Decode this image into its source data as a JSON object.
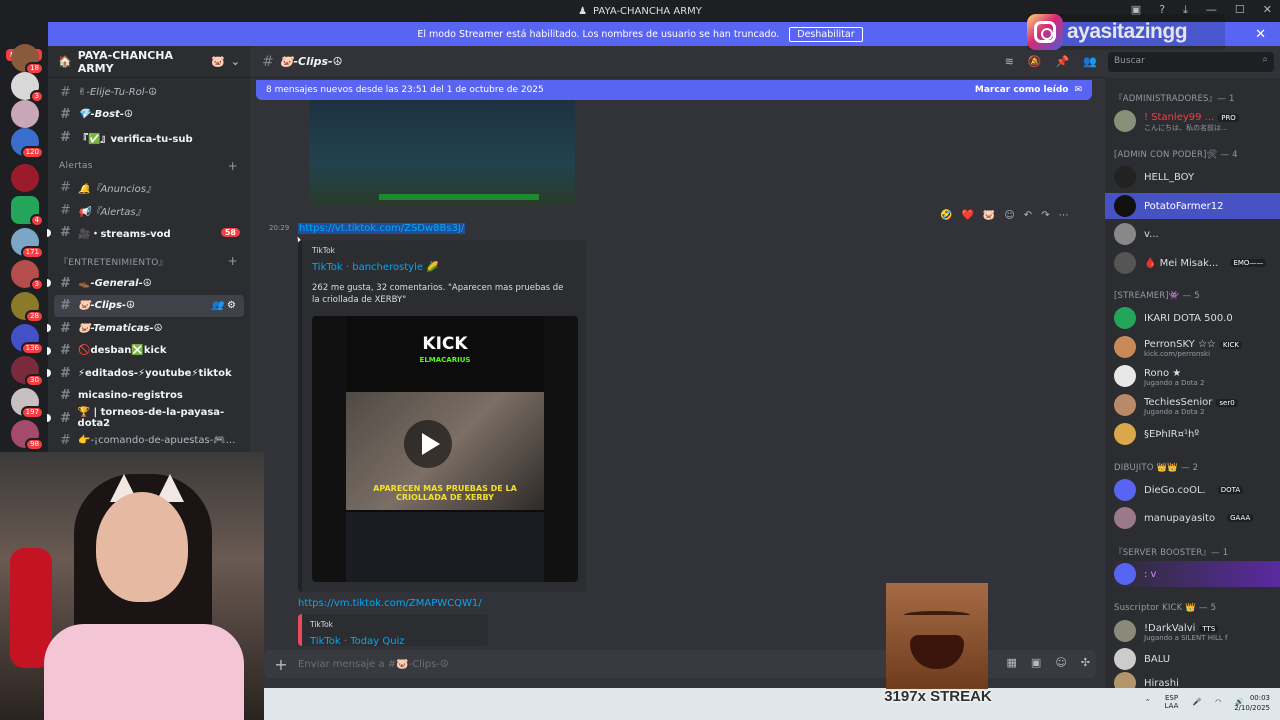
{
  "app": {
    "title": "PAYA-CHANCHA ARMY"
  },
  "banner": {
    "text": "El modo Streamer está habilitado. Los nombres de usuario se han truncado.",
    "button": "Deshabilitar"
  },
  "overlay": {
    "instagram": "ayasitazingg",
    "streak": "3197x STREAK"
  },
  "servers": {
    "new_label": "NUEVO",
    "badges": [
      "18",
      "3",
      "120",
      "4",
      "171",
      "3",
      "28",
      "136",
      "30",
      "197",
      "98"
    ]
  },
  "server": {
    "name": "PAYA-CHANCHA ARMY"
  },
  "channels": [
    {
      "name": "✌-Elije-Tu-Rol-☮",
      "style": "italic"
    },
    {
      "name": "💎-Bost-☮",
      "style": "bold"
    },
    {
      "name": "『✅』verifica-tu-sub"
    }
  ],
  "category_alerts": "Alertas",
  "alerts_channels": [
    {
      "name": "🔔『Anuncios』"
    },
    {
      "name": "📢『Alertas』"
    },
    {
      "name": "🎥・streams-vod",
      "badge": "58"
    }
  ],
  "category_ent": "『ENTRETENIMIENTO』",
  "ent_channels": [
    {
      "name": "👞-General-☮"
    },
    {
      "name": "🐷-Clips-☮"
    },
    {
      "name": "🐷-Tematicas-☮"
    },
    {
      "name": "🚫desban❎kick"
    },
    {
      "name": "⚡editados-⚡youtube⚡tiktok"
    },
    {
      "name": "micasino-registros"
    },
    {
      "name": "🏆 | torneos-de-la-payasa-dota2"
    },
    {
      "name": "👉-¡comando-de-apuestas-🎮..."
    }
  ],
  "chat": {
    "channel_name": "🐷-Clips-☮",
    "search_placeholder": "Buscar",
    "new_messages": "8 mensajes nuevos desde las 23:51 del 1 de octubre de 2025",
    "mark_read": "Marcar como leído",
    "timestamp": "20:29",
    "link1": "https://vt.tiktok.com/ZSDw8Bs3J/",
    "embed1": {
      "provider": "TikTok",
      "author": "TikTok · bancherostyle 🌽",
      "desc": "262 me gusta, 32 comentarios. \"Aparecen mas pruebas de la criollada de XERBY\"",
      "video_title": "KICK",
      "video_sub": "ELMACARIUS",
      "video_caption": "APARECEN MAS PRUEBAS DE LA CRIOLLADA DE XERBY"
    },
    "link2": "https://vm.tiktok.com/ZMAPWCQW1/",
    "embed2": {
      "provider": "TikTok",
      "author": "TikTok · Today Quiz"
    },
    "composer_placeholder": "Enviar mensaje a #🐷-Clips-☮",
    "reactions": [
      "🤣",
      "❤️",
      "🐷"
    ]
  },
  "members": {
    "groups": [
      {
        "label": "『ADMINISTRADORES』— 1",
        "items": [
          {
            "name": "! Stanley99 ...",
            "sub": "こんにちは、私の名前は...",
            "tag": "PRO",
            "color": "#f23f43"
          }
        ]
      },
      {
        "label": "[ADMIN CON PODER]🛠 — 4",
        "items": [
          {
            "name": "HELL_BOY"
          },
          {
            "name": "PotatoFarmer12"
          },
          {
            "name": "v..."
          },
          {
            "name": "🩸 Mei Misak...",
            "tag": "EMO——"
          }
        ]
      },
      {
        "label": "[STREAMER]👾 — 5",
        "items": [
          {
            "name": "IKARI DOTA 500.0"
          },
          {
            "name": "PerronSKY ☆☆",
            "sub": "kick.com/perronski",
            "tag": "KICK"
          },
          {
            "name": "Rono ★",
            "sub": "Jugando a Dota 2"
          },
          {
            "name": "TechiesSenior",
            "sub": "Jugando a Dota 2",
            "tag": "ser0"
          },
          {
            "name": "§EÞhIR¤¹hº"
          }
        ]
      },
      {
        "label": "DIBUJITO 👑👑 — 2",
        "items": [
          {
            "name": "DieGo.coOL.",
            "tag": "DOTA"
          },
          {
            "name": "manupayasito",
            "tag": "GAAA"
          }
        ]
      },
      {
        "label": "『SERVER BOOSTER』— 1",
        "items": [
          {
            "name": ": v"
          }
        ]
      },
      {
        "label": "Suscriptor KICK 👑 — 5",
        "items": [
          {
            "name": "!DarkValvi",
            "sub": "Jugando a SILENT HILL f",
            "tag": "TTS"
          },
          {
            "name": "BALU"
          },
          {
            "name": "Hirashi"
          }
        ]
      }
    ]
  },
  "taskbar": {
    "lang1": "ESP",
    "lang2": "LAA",
    "time": "00:03",
    "date": "2/10/2025"
  },
  "colors": {
    "blurple": "#5865f2",
    "bg": "#313338",
    "sidebar": "#2b2d31",
    "link": "#00a8fc"
  }
}
